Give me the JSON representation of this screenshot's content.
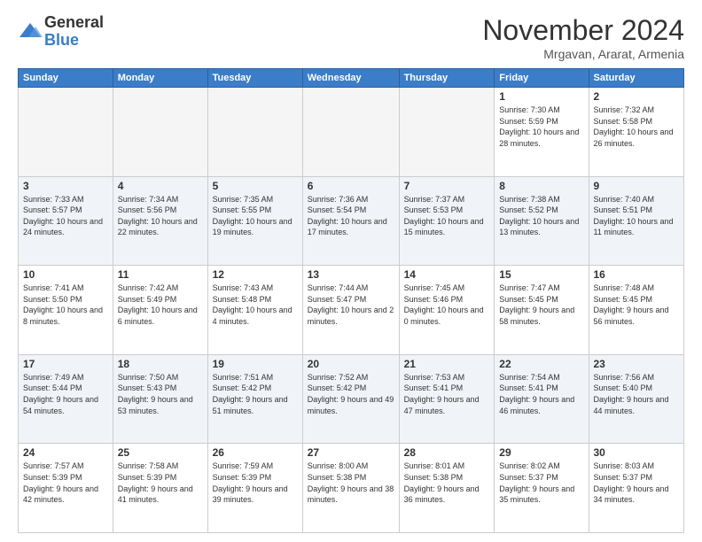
{
  "logo": {
    "general": "General",
    "blue": "Blue"
  },
  "title": "November 2024",
  "subtitle": "Mrgavan, Ararat, Armenia",
  "days_of_week": [
    "Sunday",
    "Monday",
    "Tuesday",
    "Wednesday",
    "Thursday",
    "Friday",
    "Saturday"
  ],
  "weeks": [
    [
      {
        "day": "",
        "info": ""
      },
      {
        "day": "",
        "info": ""
      },
      {
        "day": "",
        "info": ""
      },
      {
        "day": "",
        "info": ""
      },
      {
        "day": "",
        "info": ""
      },
      {
        "day": "1",
        "info": "Sunrise: 7:30 AM\nSunset: 5:59 PM\nDaylight: 10 hours and 28 minutes."
      },
      {
        "day": "2",
        "info": "Sunrise: 7:32 AM\nSunset: 5:58 PM\nDaylight: 10 hours and 26 minutes."
      }
    ],
    [
      {
        "day": "3",
        "info": "Sunrise: 7:33 AM\nSunset: 5:57 PM\nDaylight: 10 hours and 24 minutes."
      },
      {
        "day": "4",
        "info": "Sunrise: 7:34 AM\nSunset: 5:56 PM\nDaylight: 10 hours and 22 minutes."
      },
      {
        "day": "5",
        "info": "Sunrise: 7:35 AM\nSunset: 5:55 PM\nDaylight: 10 hours and 19 minutes."
      },
      {
        "day": "6",
        "info": "Sunrise: 7:36 AM\nSunset: 5:54 PM\nDaylight: 10 hours and 17 minutes."
      },
      {
        "day": "7",
        "info": "Sunrise: 7:37 AM\nSunset: 5:53 PM\nDaylight: 10 hours and 15 minutes."
      },
      {
        "day": "8",
        "info": "Sunrise: 7:38 AM\nSunset: 5:52 PM\nDaylight: 10 hours and 13 minutes."
      },
      {
        "day": "9",
        "info": "Sunrise: 7:40 AM\nSunset: 5:51 PM\nDaylight: 10 hours and 11 minutes."
      }
    ],
    [
      {
        "day": "10",
        "info": "Sunrise: 7:41 AM\nSunset: 5:50 PM\nDaylight: 10 hours and 8 minutes."
      },
      {
        "day": "11",
        "info": "Sunrise: 7:42 AM\nSunset: 5:49 PM\nDaylight: 10 hours and 6 minutes."
      },
      {
        "day": "12",
        "info": "Sunrise: 7:43 AM\nSunset: 5:48 PM\nDaylight: 10 hours and 4 minutes."
      },
      {
        "day": "13",
        "info": "Sunrise: 7:44 AM\nSunset: 5:47 PM\nDaylight: 10 hours and 2 minutes."
      },
      {
        "day": "14",
        "info": "Sunrise: 7:45 AM\nSunset: 5:46 PM\nDaylight: 10 hours and 0 minutes."
      },
      {
        "day": "15",
        "info": "Sunrise: 7:47 AM\nSunset: 5:45 PM\nDaylight: 9 hours and 58 minutes."
      },
      {
        "day": "16",
        "info": "Sunrise: 7:48 AM\nSunset: 5:45 PM\nDaylight: 9 hours and 56 minutes."
      }
    ],
    [
      {
        "day": "17",
        "info": "Sunrise: 7:49 AM\nSunset: 5:44 PM\nDaylight: 9 hours and 54 minutes."
      },
      {
        "day": "18",
        "info": "Sunrise: 7:50 AM\nSunset: 5:43 PM\nDaylight: 9 hours and 53 minutes."
      },
      {
        "day": "19",
        "info": "Sunrise: 7:51 AM\nSunset: 5:42 PM\nDaylight: 9 hours and 51 minutes."
      },
      {
        "day": "20",
        "info": "Sunrise: 7:52 AM\nSunset: 5:42 PM\nDaylight: 9 hours and 49 minutes."
      },
      {
        "day": "21",
        "info": "Sunrise: 7:53 AM\nSunset: 5:41 PM\nDaylight: 9 hours and 47 minutes."
      },
      {
        "day": "22",
        "info": "Sunrise: 7:54 AM\nSunset: 5:41 PM\nDaylight: 9 hours and 46 minutes."
      },
      {
        "day": "23",
        "info": "Sunrise: 7:56 AM\nSunset: 5:40 PM\nDaylight: 9 hours and 44 minutes."
      }
    ],
    [
      {
        "day": "24",
        "info": "Sunrise: 7:57 AM\nSunset: 5:39 PM\nDaylight: 9 hours and 42 minutes."
      },
      {
        "day": "25",
        "info": "Sunrise: 7:58 AM\nSunset: 5:39 PM\nDaylight: 9 hours and 41 minutes."
      },
      {
        "day": "26",
        "info": "Sunrise: 7:59 AM\nSunset: 5:39 PM\nDaylight: 9 hours and 39 minutes."
      },
      {
        "day": "27",
        "info": "Sunrise: 8:00 AM\nSunset: 5:38 PM\nDaylight: 9 hours and 38 minutes."
      },
      {
        "day": "28",
        "info": "Sunrise: 8:01 AM\nSunset: 5:38 PM\nDaylight: 9 hours and 36 minutes."
      },
      {
        "day": "29",
        "info": "Sunrise: 8:02 AM\nSunset: 5:37 PM\nDaylight: 9 hours and 35 minutes."
      },
      {
        "day": "30",
        "info": "Sunrise: 8:03 AM\nSunset: 5:37 PM\nDaylight: 9 hours and 34 minutes."
      }
    ]
  ]
}
